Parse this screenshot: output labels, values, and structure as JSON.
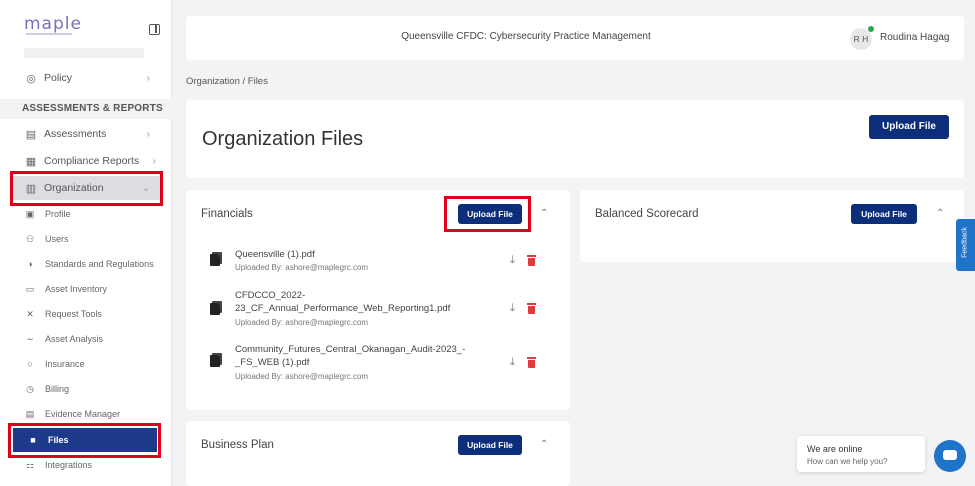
{
  "sidebar": {
    "logo": "maple",
    "top_items": [
      {
        "label": "Policy",
        "icon": "policy-icon"
      }
    ],
    "section_heading": "ASSESSMENTS & REPORTS",
    "items": [
      {
        "label": "Assessments",
        "icon": "assessments-icon"
      },
      {
        "label": "Compliance Reports",
        "icon": "compliance-reports-icon"
      },
      {
        "label": "Organization",
        "icon": "organization-icon",
        "expanded": true
      }
    ],
    "sub_items": [
      {
        "label": "Profile",
        "icon": "profile-icon"
      },
      {
        "label": "Users",
        "icon": "users-icon"
      },
      {
        "label": "Standards and Regulations",
        "icon": "standards-icon"
      },
      {
        "label": "Asset Inventory",
        "icon": "asset-inventory-icon"
      },
      {
        "label": "Request Tools",
        "icon": "request-tools-icon"
      },
      {
        "label": "Asset Analysis",
        "icon": "asset-analysis-icon"
      },
      {
        "label": "Insurance",
        "icon": "insurance-icon"
      },
      {
        "label": "Billing",
        "icon": "billing-icon"
      },
      {
        "label": "Evidence Manager",
        "icon": "evidence-manager-icon"
      },
      {
        "label": "Files",
        "icon": "files-icon",
        "active": true
      },
      {
        "label": "Integrations",
        "icon": "integrations-icon"
      }
    ]
  },
  "header": {
    "title": "Queensville CFDC: Cybersecurity Practice Management",
    "avatar_initials": "R H",
    "user_name": "Roudina Hagag"
  },
  "breadcrumb": "Organization  /  Files",
  "page": {
    "title": "Organization Files",
    "upload_label": "Upload File"
  },
  "cards": {
    "financials": {
      "title": "Financials",
      "upload_label": "Upload File",
      "files": [
        {
          "name": "Queensville (1).pdf",
          "uploaded_by": "Uploaded By: ashore@maplegrc.com"
        },
        {
          "name": "CFDCCO_2022-23_CF_Annual_Performance_Web_Reporting1.pdf",
          "uploaded_by": "Uploaded By: ashore@maplegrc.com"
        },
        {
          "name": "Community_Futures_Central_Okanagan_Audit-2023_-_FS_WEB (1).pdf",
          "uploaded_by": "Uploaded By: ashore@maplegrc.com"
        }
      ]
    },
    "balanced": {
      "title": "Balanced Scorecard",
      "upload_label": "Upload File"
    },
    "business": {
      "title": "Business Plan",
      "upload_label": "Upload File"
    }
  },
  "feedback_label": "Feedback",
  "chat": {
    "status": "We are online",
    "prompt": "How can we help you?"
  },
  "colors": {
    "primary": "#0d2e7a",
    "active_nav": "#1d3a8a",
    "highlight": "#e0001b",
    "delete": "#e23b3b",
    "feedback": "#1f73c8"
  }
}
